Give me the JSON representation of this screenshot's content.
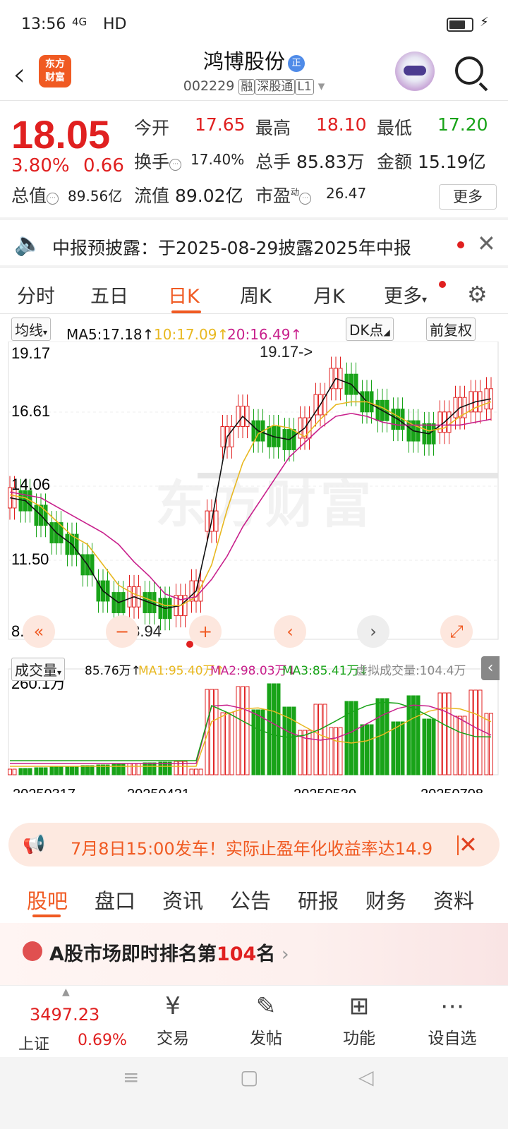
{
  "status_bar": {
    "time": "13:56",
    "network": "4G",
    "hd": "HD"
  },
  "header": {
    "back_icon": "chevron-left-icon",
    "app_logo_text": [
      "东方",
      "财富"
    ],
    "stock_name": "鸿博股份",
    "badge": "正",
    "code": "002229",
    "tags": [
      "融",
      "深股通",
      "L1"
    ]
  },
  "quote": {
    "price": "18.05",
    "change_pct": "3.80%",
    "change_abs": "0.66",
    "fields": [
      {
        "label": "今开",
        "value": "17.65",
        "color": "red"
      },
      {
        "label": "最高",
        "value": "18.10",
        "color": "red"
      },
      {
        "label": "最低",
        "value": "17.20",
        "color": "green"
      },
      {
        "label": "换手",
        "value": "17.40%",
        "color": "dark"
      },
      {
        "label": "总手",
        "value": "85.83万",
        "color": "dark"
      },
      {
        "label": "金额",
        "value": "15.19亿",
        "color": "dark"
      },
      {
        "label": "总值",
        "value": "89.56亿",
        "color": "dark"
      },
      {
        "label": "流值",
        "value": "89.02亿",
        "color": "dark"
      },
      {
        "label": "市盈",
        "value": "26.47",
        "color": "dark",
        "sup": "动"
      }
    ],
    "more_label": "更多"
  },
  "notice": {
    "text": "中报预披露：于2025-08-29披露2025年中报"
  },
  "period_tabs": [
    "分时",
    "五日",
    "日K",
    "周K",
    "月K",
    "更多"
  ],
  "active_period": "日K",
  "ma_legend": {
    "selector": "均线",
    "ma5": "MA5:17.18↑",
    "ma10": "10:17.09↑",
    "ma20": "20:16.49↑",
    "dk_label": "DK点",
    "adjust_label": "前复权"
  },
  "vol_legend": {
    "selector": "成交量",
    "vol": "85.76万↑",
    "ma1": "MA1:95.40万↑",
    "ma2": "MA2:98.03万↓",
    "ma3": "MA3:85.41万↓",
    "virtual": "虚拟成交量:104.4万"
  },
  "colors": {
    "accent": "#f05a22",
    "up": "#e02020",
    "down": "#18a318",
    "ma5": "#111111",
    "ma10": "#e8b820",
    "ma20": "#c8208c",
    "ma60": "#18a318"
  },
  "chart_data": {
    "type": "candlestick",
    "price_ticks": [
      "19.17",
      "16.61",
      "14.06",
      "11.50",
      "8.94"
    ],
    "ylim": [
      8.94,
      19.17
    ],
    "annotations": {
      "high": "19.17->",
      "low": "<-8.94"
    },
    "dates": [
      "20250317",
      "20250421",
      "20250530",
      "20250708"
    ],
    "volume_max_label": "260.1万",
    "ma_series": [
      {
        "name": "MA5",
        "values": [
          13.8,
          13.7,
          13.2,
          12.6,
          12.2,
          11.5,
          10.6,
          10.2,
          10.4,
          10.2,
          10.0,
          10.1,
          10.6,
          13.0,
          15.9,
          16.6,
          16.1,
          15.9,
          15.8,
          16.2,
          17.0,
          17.9,
          17.7,
          17.1,
          16.8,
          16.5,
          16.1,
          16.0,
          16.4,
          16.9,
          17.1,
          17.2
        ]
      },
      {
        "name": "MA10",
        "values": [
          13.9,
          13.8,
          13.5,
          13.0,
          12.5,
          12.2,
          11.5,
          10.8,
          10.5,
          10.3,
          10.1,
          10.1,
          10.4,
          11.5,
          13.4,
          15.0,
          16.0,
          16.3,
          16.2,
          15.9,
          16.5,
          17.0,
          17.1,
          17.1,
          16.9,
          16.6,
          16.3,
          16.1,
          16.2,
          16.6,
          16.9,
          17.1
        ]
      },
      {
        "name": "MA20",
        "values": [
          14.0,
          13.9,
          13.8,
          13.5,
          13.2,
          12.9,
          12.6,
          12.2,
          11.6,
          11.1,
          10.5,
          10.3,
          10.4,
          11.0,
          11.8,
          12.8,
          13.6,
          14.4,
          15.2,
          15.7,
          16.2,
          16.6,
          16.7,
          16.6,
          16.4,
          16.3,
          16.3,
          16.3,
          16.3,
          16.3,
          16.4,
          16.5
        ]
      }
    ]
  },
  "promo": {
    "text": "7月8日15:00发车！实际止盈年化收益率达14.9"
  },
  "content_tabs": [
    "股吧",
    "盘口",
    "资讯",
    "公告",
    "研报",
    "财务",
    "资料"
  ],
  "active_content_tab": "股吧",
  "rank": {
    "prefix": "A股市场即时排名第",
    "number": "104",
    "suffix": "名"
  },
  "bottom_nav": {
    "index_value": "3497.23",
    "index_name": "上证",
    "index_pct": "0.69%",
    "items": [
      {
        "label": "交易",
        "icon": "yen-cycle-icon"
      },
      {
        "label": "发帖",
        "icon": "edit-icon"
      },
      {
        "label": "功能",
        "icon": "grid-icon"
      },
      {
        "label": "设自选",
        "icon": "more-circle-icon"
      }
    ]
  }
}
